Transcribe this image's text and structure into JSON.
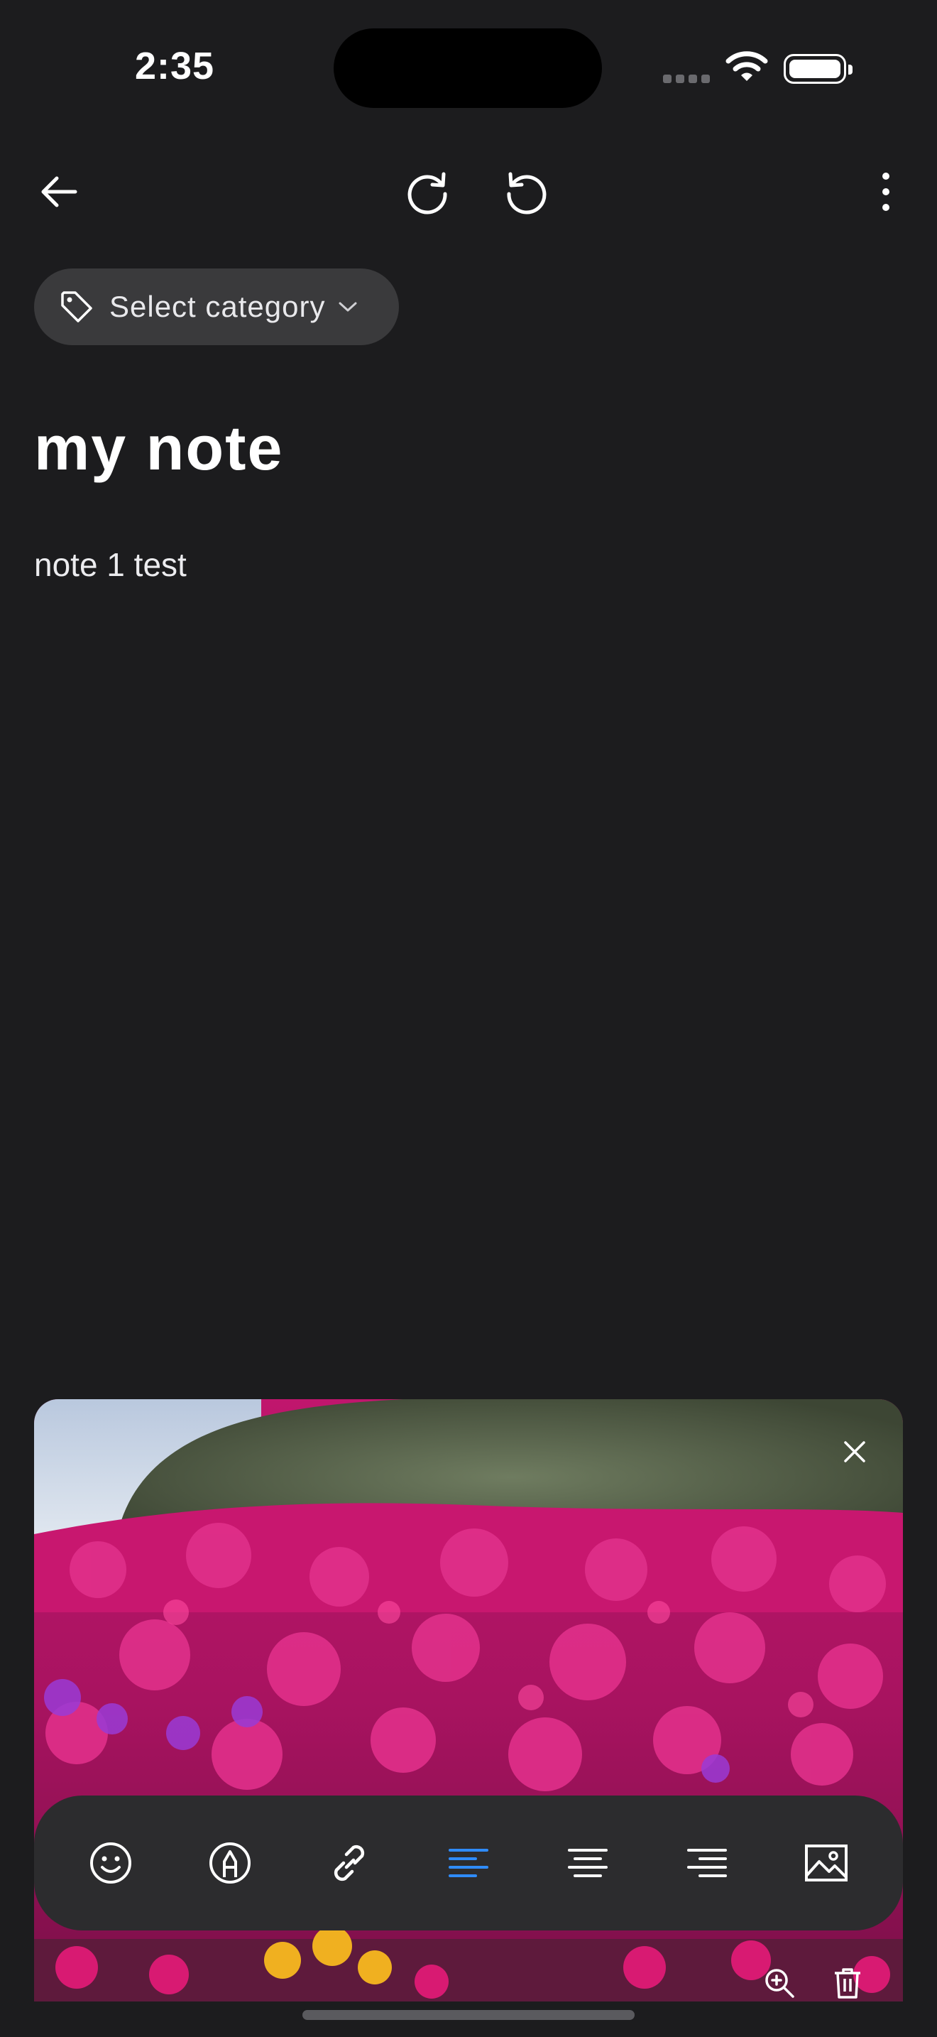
{
  "status_bar": {
    "time": "2:35"
  },
  "toolbar": {
    "back_icon": "arrow-left-icon",
    "redo_icon": "redo-icon",
    "undo_icon": "undo-icon",
    "more_icon": "more-vertical-icon"
  },
  "category": {
    "label": "Select category",
    "icon": "tag-icon"
  },
  "note": {
    "title": "my note",
    "body": "note 1 test"
  },
  "image": {
    "description_icon": "flower-photo"
  },
  "format_toolbar": {
    "items": [
      {
        "icon": "emoji-icon"
      },
      {
        "icon": "text-style-icon"
      },
      {
        "icon": "link-icon"
      },
      {
        "icon": "align-left-icon",
        "active": true
      },
      {
        "icon": "align-center-icon"
      },
      {
        "icon": "align-right-icon"
      },
      {
        "icon": "image-icon"
      }
    ],
    "active_color": "#2f8cff"
  }
}
